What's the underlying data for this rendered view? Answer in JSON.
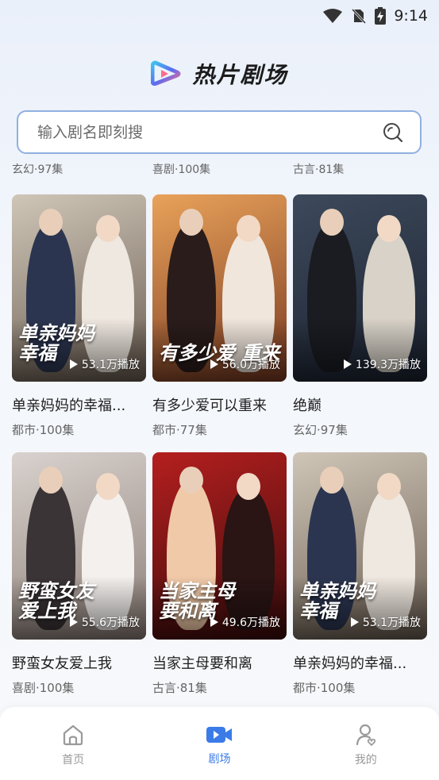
{
  "status_bar": {
    "time": "9:14"
  },
  "header": {
    "title": "热片剧场"
  },
  "search": {
    "placeholder": "输入剧名即刻搜"
  },
  "partial_row": [
    "玄幻·97集",
    "喜剧·100集",
    "古言·81集"
  ],
  "dramas": [
    {
      "title": "单亲妈妈的幸福...",
      "meta": "都市·100集",
      "plays": "53.1万播放",
      "art_text": "单亲妈妈\n幸福",
      "bg": [
        "#cfc6b8",
        "#6b5e52"
      ],
      "fig": [
        "#2c3550",
        "#efe8e0"
      ]
    },
    {
      "title": "有多少爱可以重来",
      "meta": "都市·77集",
      "plays": "56.0万播放",
      "art_text": "有多少爱 重来",
      "bg": [
        "#e9a25a",
        "#7a3a22"
      ],
      "fig": [
        "#2a1c1a",
        "#f0e6dc"
      ]
    },
    {
      "title": "绝巅",
      "meta": "玄幻·97集",
      "plays": "139.3万播放",
      "art_text": "",
      "bg": [
        "#3d4a5c",
        "#1b2230"
      ],
      "fig": [
        "#1a1c22",
        "#d8d2c8"
      ]
    },
    {
      "title": "野蛮女友爱上我",
      "meta": "喜剧·100集",
      "plays": "55.6万播放",
      "art_text": "野蛮女友\n爱上我",
      "bg": [
        "#d9d2ce",
        "#8d7f78"
      ],
      "fig": [
        "#3a3436",
        "#f4f0ee"
      ]
    },
    {
      "title": "当家主母要和离",
      "meta": "古言·81集",
      "plays": "49.6万播放",
      "art_text": "当家主母\n要和离",
      "bg": [
        "#b51f1f",
        "#3a0b0b"
      ],
      "fig": [
        "#f0c9a8",
        "#2a1414"
      ]
    },
    {
      "title": "单亲妈妈的幸福...",
      "meta": "都市·100集",
      "plays": "53.1万播放",
      "art_text": "单亲妈妈\n幸福",
      "bg": [
        "#cfc6b8",
        "#6b5e52"
      ],
      "fig": [
        "#2c3550",
        "#efe8e0"
      ]
    }
  ],
  "nav": [
    {
      "label": "首页",
      "icon": "home-icon",
      "active": false
    },
    {
      "label": "剧场",
      "icon": "theater-icon",
      "active": true
    },
    {
      "label": "我的",
      "icon": "profile-icon",
      "active": false
    }
  ],
  "colors": {
    "accent": "#3b7be8",
    "search_border": "#8fb0e0"
  }
}
